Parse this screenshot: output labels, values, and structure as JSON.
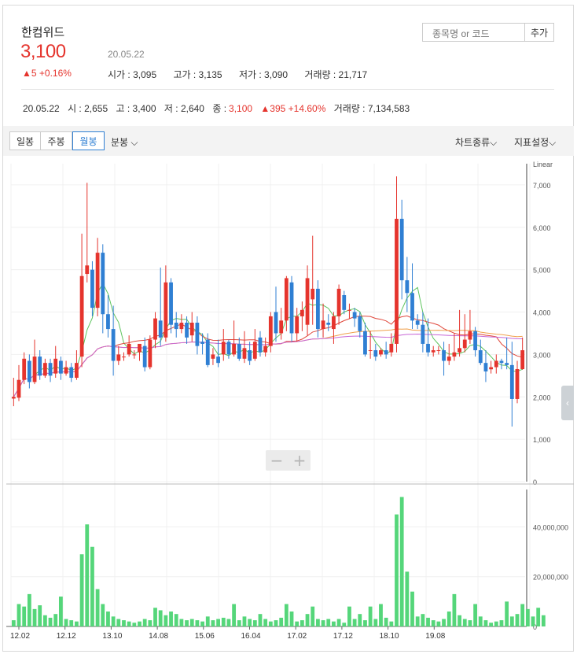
{
  "header": {
    "name": "한컴위드",
    "price": "3,100",
    "date": "20.05.22",
    "change": "▲5 +0.16%",
    "open": "시가 : 3,095",
    "high": "고가 : 3,135",
    "low": "저가 : 3,090",
    "volume": "거래량 : 21,717"
  },
  "search": {
    "placeholder": "종목명 or 코드",
    "add_label": "추가"
  },
  "summary": {
    "date": "20.05.22",
    "open": "시 : 2,655",
    "high": "고 : 3,400",
    "low": "저 : 2,640",
    "close_label": "종 :",
    "close": "3,100",
    "change": "▲395 +14.60%",
    "volume": "거래량 : 7,134,583"
  },
  "toolbar": {
    "daily": "일봉",
    "weekly": "주봉",
    "monthly": "월봉",
    "minute": "분봉",
    "chart_type": "차트종류",
    "indicator": "지표설정"
  },
  "colors": {
    "up": "#e5342d",
    "down": "#2f7fd3",
    "volume": "#55d67a",
    "ma5": "#5ec45e",
    "ma20": "#e0473b",
    "ma60": "#f0a04b",
    "ma120": "#c766d6"
  },
  "chart_data": {
    "type": "candlestick",
    "scale": "Linear",
    "price_ylim": [
      0,
      7500
    ],
    "price_ticks": [
      "0",
      "1,000",
      "2,000",
      "3,000",
      "4,000",
      "5,000",
      "6,000",
      "7,000"
    ],
    "volume_ylim": [
      0,
      55000000
    ],
    "volume_ticks": [
      "0",
      "20,000,000",
      "40,000,000"
    ],
    "x_ticks": [
      "12.02",
      "12.12",
      "13.10",
      "14.08",
      "15.06",
      "16.04",
      "17.02",
      "17.12",
      "18.10",
      "19.08"
    ],
    "candles": [
      [
        1960,
        2000,
        1780,
        2450
      ],
      [
        1980,
        2400,
        1900,
        2750
      ],
      [
        2400,
        2900,
        2300,
        3050
      ],
      [
        2850,
        2350,
        2200,
        3000
      ],
      [
        2350,
        2950,
        2300,
        3350
      ],
      [
        2950,
        2500,
        2400,
        3100
      ],
      [
        2500,
        2800,
        2450,
        2900
      ],
      [
        2800,
        2500,
        2350,
        2900
      ],
      [
        2550,
        2900,
        2450,
        3200
      ],
      [
        2850,
        2550,
        2400,
        2950
      ],
      [
        2550,
        2700,
        2500,
        2850
      ],
      [
        2700,
        2450,
        2350,
        2800
      ],
      [
        2450,
        2800,
        2400,
        3100
      ],
      [
        2950,
        4850,
        2700,
        5850
      ],
      [
        4900,
        5100,
        4700,
        7050
      ],
      [
        5000,
        4100,
        3900,
        5200
      ],
      [
        4100,
        5400,
        3900,
        5750
      ],
      [
        5400,
        3950,
        3500,
        5600
      ],
      [
        3950,
        3600,
        3400,
        4400
      ],
      [
        3600,
        2850,
        2500,
        4150
      ],
      [
        2850,
        3000,
        2750,
        3200
      ],
      [
        2950,
        2950,
        2850,
        3050
      ],
      [
        3000,
        3250,
        2950,
        3450
      ],
      [
        3000,
        3000,
        2900,
        3100
      ],
      [
        3050,
        3250,
        2850,
        3200
      ],
      [
        3200,
        2700,
        2600,
        3400
      ],
      [
        2700,
        3350,
        2650,
        3450
      ],
      [
        3350,
        3850,
        3150,
        4000
      ],
      [
        3800,
        3400,
        3200,
        5050
      ],
      [
        3400,
        4700,
        3300,
        5100
      ],
      [
        4700,
        3700,
        3500,
        4800
      ],
      [
        3750,
        3600,
        3400,
        4000
      ],
      [
        3600,
        3750,
        3500,
        3950
      ],
      [
        3750,
        3400,
        3250,
        3900
      ],
      [
        3450,
        3750,
        3300,
        4000
      ],
      [
        3750,
        3200,
        3000,
        3900
      ],
      [
        3300,
        3250,
        3000,
        3500
      ],
      [
        3350,
        2750,
        2700,
        3500
      ],
      [
        2900,
        3000,
        2750,
        3150
      ],
      [
        2950,
        2800,
        2700,
        3350
      ],
      [
        3000,
        3300,
        2850,
        3600
      ],
      [
        3300,
        3000,
        2900,
        3350
      ],
      [
        3000,
        3250,
        2950,
        3800
      ],
      [
        3250,
        2900,
        2850,
        3400
      ],
      [
        2900,
        3150,
        2800,
        3550
      ],
      [
        3100,
        2850,
        2750,
        3300
      ],
      [
        2900,
        3300,
        2850,
        3600
      ],
      [
        3400,
        3050,
        2950,
        3550
      ],
      [
        3050,
        3200,
        2950,
        3400
      ],
      [
        3200,
        3900,
        3050,
        4000
      ],
      [
        4000,
        3500,
        3300,
        4600
      ],
      [
        3500,
        3800,
        3350,
        4100
      ],
      [
        3800,
        4800,
        3550,
        4850
      ],
      [
        4700,
        3500,
        3300,
        4850
      ],
      [
        3500,
        3900,
        3300,
        4100
      ],
      [
        3900,
        4050,
        3550,
        4250
      ],
      [
        3700,
        4800,
        3450,
        5100
      ],
      [
        4300,
        4550,
        3700,
        5800
      ],
      [
        4550,
        3600,
        3400,
        4750
      ],
      [
        3600,
        3800,
        3400,
        4200
      ],
      [
        3750,
        3700,
        3550,
        3950
      ],
      [
        3600,
        3900,
        3250,
        4000
      ],
      [
        3900,
        4550,
        3700,
        4650
      ],
      [
        4400,
        4050,
        3950,
        4500
      ],
      [
        4050,
        4050,
        3850,
        4200
      ],
      [
        4000,
        3850,
        3650,
        4100
      ],
      [
        3900,
        3550,
        3400,
        4000
      ],
      [
        3550,
        3000,
        2950,
        3750
      ],
      [
        3100,
        3100,
        2900,
        3550
      ],
      [
        3100,
        2950,
        2850,
        3250
      ],
      [
        3000,
        3100,
        2950,
        3150
      ],
      [
        3100,
        3000,
        2900,
        3300
      ],
      [
        3050,
        3250,
        2950,
        3500
      ],
      [
        3250,
        6200,
        3050,
        7200
      ],
      [
        6200,
        4750,
        4300,
        6650
      ],
      [
        4750,
        4450,
        4000,
        5300
      ],
      [
        4450,
        3800,
        3600,
        5150
      ],
      [
        3800,
        3700,
        3600,
        3950
      ],
      [
        3700,
        3250,
        3050,
        4000
      ],
      [
        3250,
        3050,
        2950,
        3850
      ],
      [
        3050,
        3100,
        2950,
        3200
      ],
      [
        3100,
        3100,
        3000,
        3200
      ],
      [
        3100,
        2850,
        2500,
        3300
      ],
      [
        2850,
        2950,
        2750,
        3250
      ],
      [
        2950,
        3050,
        2850,
        3500
      ],
      [
        3050,
        3150,
        2950,
        4050
      ],
      [
        3150,
        3350,
        3050,
        3950
      ],
      [
        3350,
        3550,
        3250,
        4050
      ],
      [
        3550,
        3100,
        2950,
        3650
      ],
      [
        3100,
        2800,
        2750,
        3350
      ],
      [
        2800,
        2600,
        2350,
        3100
      ],
      [
        2650,
        2700,
        2550,
        2850
      ],
      [
        2700,
        2850,
        2550,
        3000
      ],
      [
        2850,
        2800,
        2650,
        2900
      ],
      [
        2800,
        2750,
        2650,
        3400
      ],
      [
        2750,
        1950,
        1300,
        3300
      ],
      [
        1950,
        2655,
        1850,
        2850
      ],
      [
        2655,
        3100,
        2640,
        3400
      ]
    ],
    "volume": [
      2500000,
      9000000,
      8000000,
      13000000,
      7000000,
      8500000,
      4500000,
      3500000,
      5000000,
      12000000,
      3000000,
      2500000,
      2000000,
      29000000,
      41000000,
      32000000,
      15000000,
      9000000,
      6000000,
      4000000,
      3000000,
      2500000,
      2000000,
      1500000,
      2000000,
      3000000,
      2500000,
      7500000,
      6500000,
      4500000,
      6000000,
      5000000,
      3000000,
      2500000,
      3000000,
      2500000,
      2000000,
      4000000,
      2500000,
      3000000,
      3500000,
      3000000,
      9000000,
      2500000,
      4000000,
      3000000,
      2500000,
      5000000,
      3000000,
      2000000,
      2500000,
      3500000,
      9000000,
      6000000,
      2000000,
      2500000,
      5000000,
      8000000,
      3000000,
      2500000,
      3000000,
      2000000,
      3000000,
      1500000,
      8000000,
      3000000,
      5000000,
      2500000,
      8000000,
      3000000,
      9000000,
      3500000,
      2000000,
      45000000,
      52000000,
      22000000,
      14000000,
      4000000,
      5000000,
      3500000,
      2500000,
      2000000,
      3000000,
      6000000,
      13000000,
      4500000,
      3000000,
      2500000,
      9000000,
      4000000,
      2500000,
      1500000,
      2000000,
      2500000,
      10000000,
      4000000,
      5000000,
      9000000,
      7000000,
      4000000,
      7500000,
      4500000
    ]
  }
}
